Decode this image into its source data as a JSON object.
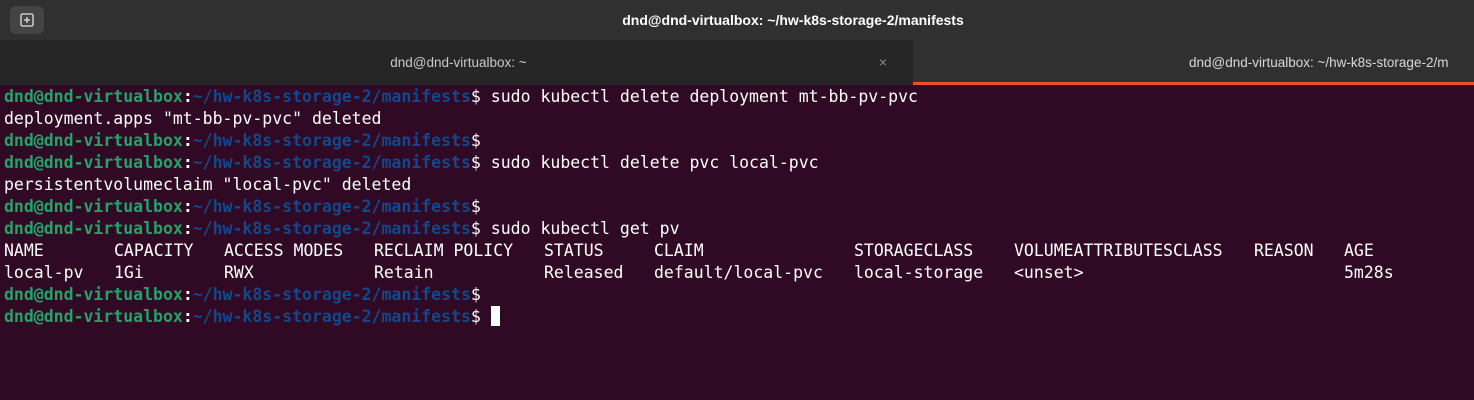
{
  "window": {
    "title": "dnd@dnd-virtualbox: ~/hw-k8s-storage-2/manifests"
  },
  "tabs": [
    {
      "label": "dnd@dnd-virtualbox: ~",
      "close": "×"
    },
    {
      "label": "dnd@dnd-virtualbox: ~/hw-k8s-storage-2/m"
    }
  ],
  "prompt": {
    "user_host": "dnd@dnd-virtualbox",
    "colon": ":",
    "path": "~/hw-k8s-storage-2/manifests",
    "dollar": "$"
  },
  "lines": [
    {
      "type": "prompt",
      "command": " sudo kubectl delete deployment mt-bb-pv-pvc"
    },
    {
      "type": "output",
      "text": "deployment.apps \"mt-bb-pv-pvc\" deleted"
    },
    {
      "type": "prompt",
      "command": ""
    },
    {
      "type": "prompt",
      "command": " sudo kubectl delete pvc local-pvc"
    },
    {
      "type": "output",
      "text": "persistentvolumeclaim \"local-pvc\" deleted"
    },
    {
      "type": "prompt",
      "command": ""
    },
    {
      "type": "prompt",
      "command": " sudo kubectl get pv"
    }
  ],
  "pv_table": {
    "headers": [
      "NAME",
      "CAPACITY",
      "ACCESS MODES",
      "RECLAIM POLICY",
      "STATUS",
      "CLAIM",
      "STORAGECLASS",
      "VOLUMEATTRIBUTESCLASS",
      "REASON",
      "AGE"
    ],
    "rows": [
      [
        "local-pv",
        "1Gi",
        "RWX",
        "Retain",
        "Released",
        "default/local-pvc",
        "local-storage",
        "<unset>",
        "",
        "5m28s"
      ]
    ]
  },
  "trailing_prompts": [
    {
      "command": ""
    },
    {
      "command": " ",
      "cursor": true
    }
  ],
  "colors": {
    "background": "#300a24",
    "prompt_user": "#26a269",
    "prompt_path": "#12488b",
    "active_tab_accent": "#e95420"
  }
}
